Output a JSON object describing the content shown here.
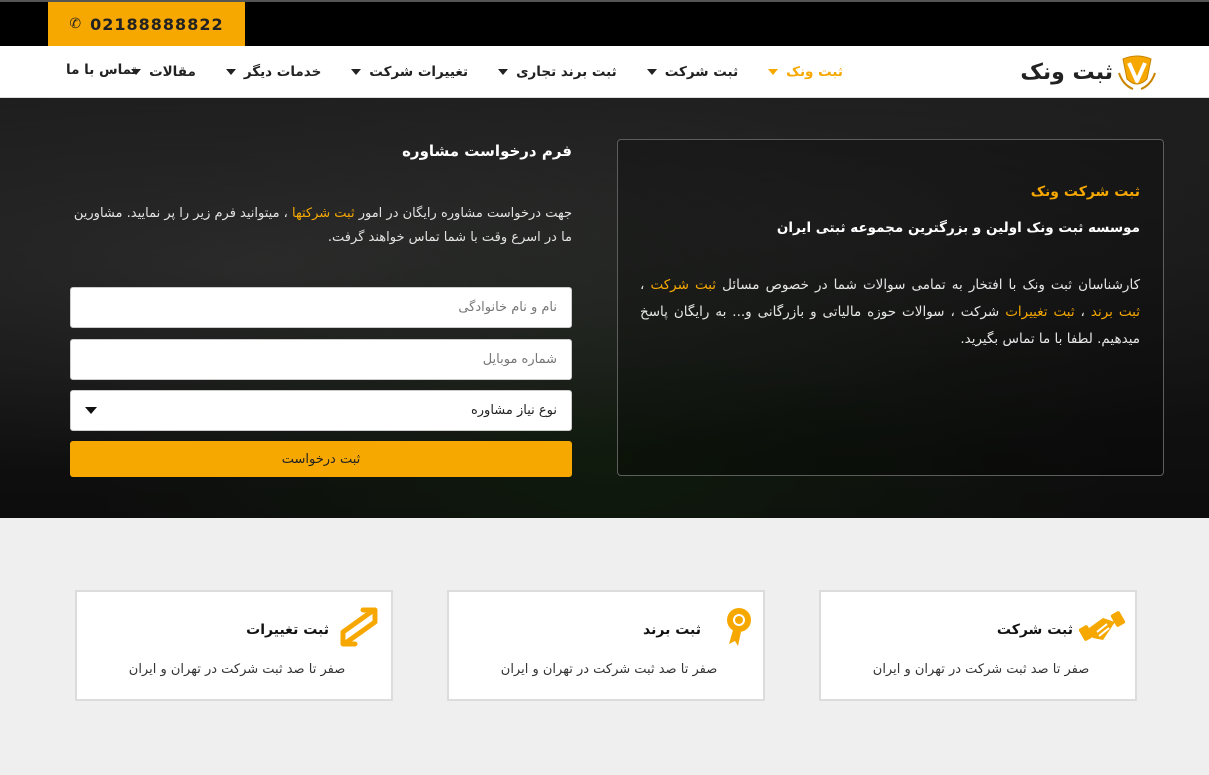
{
  "topbar": {
    "phone": "02188888822",
    "phone_icon": "phone-icon"
  },
  "nav": {
    "logo_text": "ثبت ونک",
    "items": [
      {
        "label": "ثبت ونک",
        "active": true
      },
      {
        "label": "ثبت شرکت"
      },
      {
        "label": "ثبت برند تجاری"
      },
      {
        "label": "تغییرات شرکت"
      },
      {
        "label": "خدمات دیگر"
      },
      {
        "label": "مقالات"
      }
    ],
    "contact": "تماس با ما"
  },
  "info": {
    "title": "ثبت شرکت ونک",
    "subtitle": "موسسه ثبت ونک اولین و بزرگترین مجموعه ثبتی ایران",
    "body_1": "کارشناسان ثبت ونک با افتخار به تمامی سوالات شما در خصوص مسائل ",
    "link_1": "ثبت شرکت",
    "body_2": " ، ",
    "link_2": "ثبت برند",
    "body_3": " ، ",
    "link_3": "ثبت تغییرات",
    "body_4": " شرکت ، سوالات حوزه مالیاتی و بازرگانی و... به رایگان پاسخ میدهیم. لطفا با ما تماس بگیرید."
  },
  "form": {
    "title": "فرم درخواست مشاوره",
    "desc_1": "جهت درخواست مشاوره رایگان در امور ",
    "desc_link": "ثبت شرکتها",
    "desc_2": " ، میتوانید فرم زیر را پر نمایید. مشاورین ما در اسرع وقت با شما تماس خواهند گرفت.",
    "name_placeholder": "نام و نام خانوادگی",
    "mobile_placeholder": "شماره موبایل",
    "select_value": "نوع نیاز مشاوره",
    "submit": "ثبت درخواست"
  },
  "cards": [
    {
      "title": "ثبت شرکت",
      "desc": "صفر تا صد ثبت شرکت در تهران و ایران",
      "icon": "handshake-icon"
    },
    {
      "title": "ثبت برند",
      "desc": "صفر تا صد ثبت شرکت در تهران و ایران",
      "icon": "award-badge-icon"
    },
    {
      "title": "ثبت تغییرات",
      "desc": "صفر تا صد ثبت شرکت در تهران و ایران",
      "icon": "exchange-arrows-icon"
    }
  ],
  "colors": {
    "accent": "#f6a800",
    "topbar": "#000000",
    "nav_bg": "#ffffff",
    "page_bg": "#efefef"
  }
}
